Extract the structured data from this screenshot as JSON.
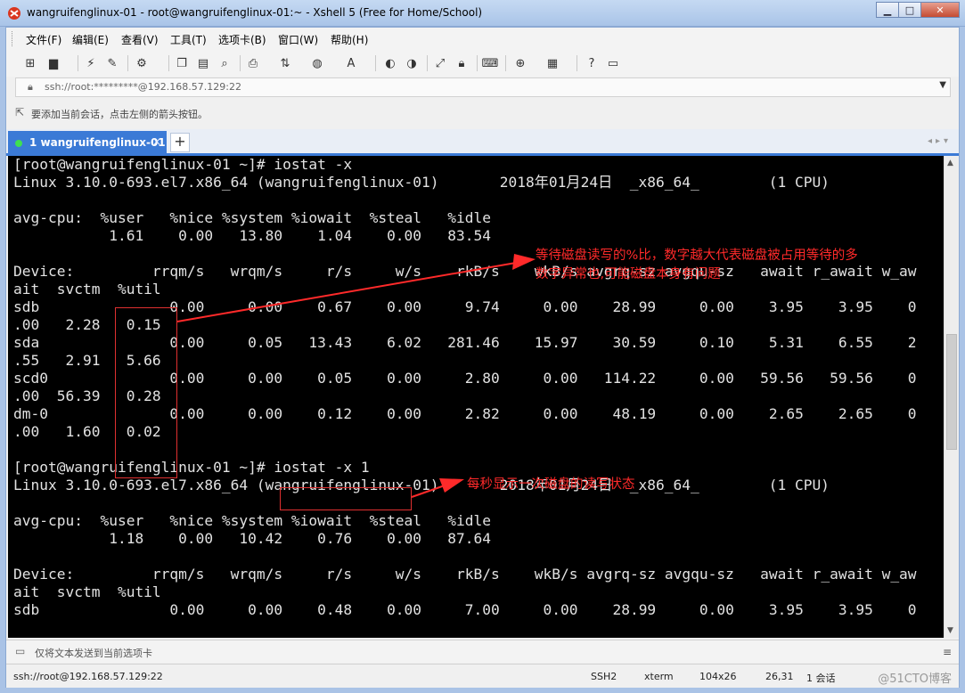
{
  "window": {
    "title": "wangruifenglinux-01 - root@wangruifenglinux-01:~ - Xshell 5 (Free for Home/School)",
    "minimize": "▁",
    "maximize": "□",
    "close": "✕"
  },
  "menu": [
    "文件(F)",
    "编辑(E)",
    "查看(V)",
    "工具(T)",
    "选项卡(B)",
    "窗口(W)",
    "帮助(H)"
  ],
  "address": {
    "value": "ssh://root:*********@192.168.57.129:22"
  },
  "hint": "要添加当前会话，点击左侧的箭头按钮。",
  "tab": {
    "label": "1 wangruifenglinux-01",
    "close": "×",
    "new": "+"
  },
  "terminal": {
    "lines": [
      "[root@wangruifenglinux-01 ~]# iostat -x",
      "Linux 3.10.0-693.el7.x86_64 (wangruifenglinux-01)       2018年01月24日  _x86_64_        (1 CPU)",
      "",
      "avg-cpu:  %user   %nice %system %iowait  %steal   %idle",
      "           1.61    0.00   13.80    1.04    0.00   83.54",
      "",
      "Device:         rrqm/s   wrqm/s     r/s     w/s    rkB/s    wkB/s avgrq-sz avgqu-sz   await r_await w_aw",
      "ait  svctm  %util",
      "sdb               0.00     0.00    0.67    0.00     9.74     0.00    28.99     0.00    3.95    3.95    0",
      ".00   2.28   0.15",
      "sda               0.00     0.05   13.43    6.02   281.46    15.97    30.59     0.10    5.31    6.55    2",
      ".55   2.91   5.66",
      "scd0              0.00     0.00    0.05    0.00     2.80     0.00   114.22     0.00   59.56   59.56    0",
      ".00  56.39   0.28",
      "dm-0              0.00     0.00    0.12    0.00     2.82     0.00    48.19     0.00    2.65    2.65    0",
      ".00   1.60   0.02",
      "",
      "[root@wangruifenglinux-01 ~]# iostat -x 1",
      "Linux 3.10.0-693.el7.x86_64 (wangruifenglinux-01)       2018年01月24日  _x86_64_        (1 CPU)",
      "",
      "avg-cpu:  %user   %nice %system %iowait  %steal   %idle",
      "           1.18    0.00   10.42    0.76    0.00   87.64",
      "",
      "Device:         rrqm/s   wrqm/s     r/s     w/s    rkB/s    wkB/s avgrq-sz avgqu-sz   await r_await w_aw",
      "ait  svctm  %util",
      "sdb               0.00     0.00    0.48    0.00     7.00     0.00    28.99     0.00    3.95    3.95    0"
    ]
  },
  "annotations": {
    "util_line1": "等待磁盘读写的%比，数字越大代表磁盘被占用等待的多",
    "util_line2": "数字异常也,可能磁盘本身有问题",
    "cmd_note": "每秒显示一次磁盘的读写状态",
    "color": "#ff2a2a"
  },
  "sendbar": {
    "text": "仅将文本发送到当前选项卡"
  },
  "status": {
    "address": "ssh://root@192.168.57.129:22",
    "protocol": "SSH2",
    "term": "xterm",
    "size": "104x26",
    "cursor": "26,31",
    "sessions": "1 会话",
    "watermark": "@51CTO博客"
  },
  "icons": [
    "new-session-icon",
    "open-folder-icon",
    "connect-icon",
    "disconnect-icon",
    "properties-icon",
    "copy-icon",
    "paste-icon",
    "find-icon",
    "print-icon",
    "transfer-icon",
    "globe-icon",
    "font-icon",
    "xftp-icon",
    "xmanager-icon",
    "fullscreen-icon",
    "lock-icon",
    "keyboard-icon",
    "add-icon",
    "layout-icon",
    "help-icon",
    "chat-icon"
  ]
}
